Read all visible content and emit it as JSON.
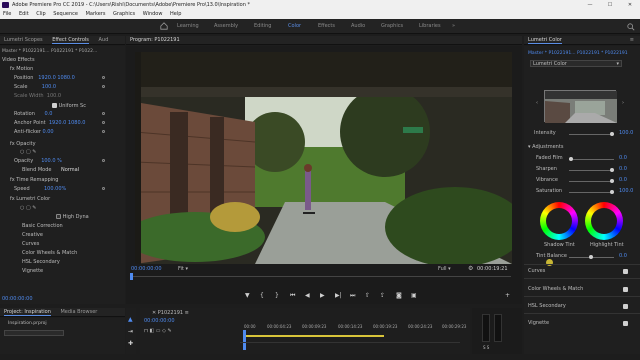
{
  "window": {
    "title": "Adobe Premiere Pro CC 2019 - C:\\Users\\Rishi\\Documents\\Adobe\\Premiere Pro\\13.0\\Inspiration *",
    "min": "—",
    "max": "☐",
    "close": "✕"
  },
  "menu": [
    "File",
    "Edit",
    "Clip",
    "Sequence",
    "Markers",
    "Graphics",
    "Window",
    "Help"
  ],
  "workspaces": [
    "Learning",
    "Assembly",
    "Editing",
    "Color",
    "Effects",
    "Audio",
    "Graphics",
    "Libraries"
  ],
  "active_workspace": "Color",
  "left_panel": {
    "tabs": [
      "Lumetri Scopes",
      "Effect Controls",
      "Aud"
    ],
    "active_tab": "Effect Controls",
    "source_line": "Master * P1022191...  P1022191 * P1022...",
    "section": "Video Effects",
    "rows": [
      {
        "label": "fx  Motion",
        "value": ""
      },
      {
        "label": "Position",
        "value": "1920.0   1080.0"
      },
      {
        "label": "Scale",
        "value": "100.0"
      },
      {
        "label": "Scale Width",
        "value": "100.0"
      },
      {
        "label": "Uniform Sc",
        "value": ""
      },
      {
        "label": "Rotation",
        "value": "0.0"
      },
      {
        "label": "Anchor Point",
        "value": "1920.0   1080.0"
      },
      {
        "label": "Anti-flicker",
        "value": "0.00"
      },
      {
        "label": "fx  Opacity",
        "value": ""
      },
      {
        "label": "Opacity",
        "value": "100.0 %"
      },
      {
        "label": "Blend Mode",
        "value": "Normal"
      },
      {
        "label": "fx  Time Remapping",
        "value": ""
      },
      {
        "label": "Speed",
        "value": "100.00%"
      },
      {
        "label": "fx  Lumetri Color",
        "value": ""
      },
      {
        "label": "High Dyna",
        "value": ""
      },
      {
        "label": "Basic Correction",
        "value": ""
      },
      {
        "label": "Creative",
        "value": ""
      },
      {
        "label": "Curves",
        "value": ""
      },
      {
        "label": "Color Wheels & Match",
        "value": ""
      },
      {
        "label": "HSL Secondary",
        "value": ""
      },
      {
        "label": "Vignette",
        "value": ""
      }
    ],
    "timecode": "00:00:00:00"
  },
  "program": {
    "title": "Program: P1022191",
    "timecode_left": "00:00:00:00",
    "fit": "Fit",
    "quality": "Full",
    "timecode_right": "00:00:19:21"
  },
  "lumetri": {
    "title": "Lumetri Color",
    "source_line": "Master * P1022191...  P1022191 * P1022191",
    "effect_select": "Lumetri Color",
    "intensity_label": "Intensity",
    "intensity_value": "100.0",
    "adjustments_label": "Adjustments",
    "sliders": [
      {
        "label": "Faded Film",
        "value": "0.0",
        "pos": 0.15
      },
      {
        "label": "Sharpen",
        "value": "0.0",
        "pos": 0.5
      },
      {
        "label": "Vibrance",
        "value": "0.0",
        "pos": 0.5
      },
      {
        "label": "Saturation",
        "value": "100.0",
        "pos": 0.5
      }
    ],
    "wheel_left": "Shadow Tint",
    "wheel_right": "Highlight Tint",
    "tint_balance_label": "Tint Balance",
    "tint_balance_value": "0.0",
    "sections": [
      "Curves",
      "Color Wheels & Match",
      "HSL Secondary",
      "Vignette"
    ]
  },
  "project": {
    "tabs": [
      "Project: Inspiration",
      "Media Browser"
    ],
    "file": "Inspiration.prproj"
  },
  "timeline": {
    "sequence": "P1022191",
    "timecode": "00:00:00:00",
    "ruler": [
      "00:00",
      "00:00:04:23",
      "00:00:09:23",
      "00:00:14:23",
      "00:00:19:23",
      "00:00:24:23",
      "00:00:29:23"
    ],
    "meter_label": "S S"
  },
  "colors": {
    "accent": "#5b8ee6",
    "timecode": "#4f8bf0",
    "ui_bg": "#1d1d1d"
  }
}
